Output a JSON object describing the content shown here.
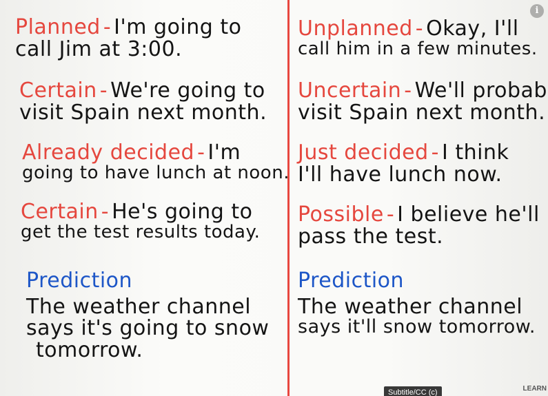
{
  "left": [
    {
      "label": "Planned",
      "lines": [
        "I'm going to",
        "call Jim at 3:00."
      ],
      "label_color": "#e5473e"
    },
    {
      "label": "Certain",
      "lines": [
        "We're going to",
        "visit Spain next month."
      ],
      "label_color": "#e5473e"
    },
    {
      "label": "Already decided",
      "lines": [
        "I'm",
        "going to have lunch at noon."
      ],
      "label_color": "#e5473e"
    },
    {
      "label": "Certain",
      "lines": [
        "He's going to",
        "get the test results today."
      ],
      "label_color": "#e5473e"
    },
    {
      "label": "Prediction",
      "lines": [
        "The weather channel",
        "says it's going to snow",
        "tomorrow."
      ],
      "label_color": "#1d56c7"
    }
  ],
  "right": [
    {
      "label": "Unplanned",
      "lines": [
        "Okay, I'll",
        "call him in a few minutes."
      ],
      "label_color": "#e5473e"
    },
    {
      "label": "Uncertain",
      "lines": [
        "We'll probably",
        "visit Spain next month."
      ],
      "label_color": "#e5473e"
    },
    {
      "label": "Just decided",
      "lines": [
        "I think",
        "I'll have lunch now."
      ],
      "label_color": "#e5473e"
    },
    {
      "label": "Possible",
      "lines": [
        "I believe he'll",
        "pass the test."
      ],
      "label_color": "#e5473e"
    },
    {
      "label": "Prediction",
      "lines": [
        "The weather channel",
        "says it'll snow tomorrow."
      ],
      "label_color": "#1d56c7"
    }
  ],
  "player": {
    "info_icon": "info-icon",
    "subtitle_button": "Subtitle/CC (c)",
    "logo_text": "LEARN"
  },
  "colors": {
    "divider": "#e8473f",
    "ink": "#141414",
    "red_marker": "#e5473e",
    "blue_marker": "#1d56c7"
  }
}
